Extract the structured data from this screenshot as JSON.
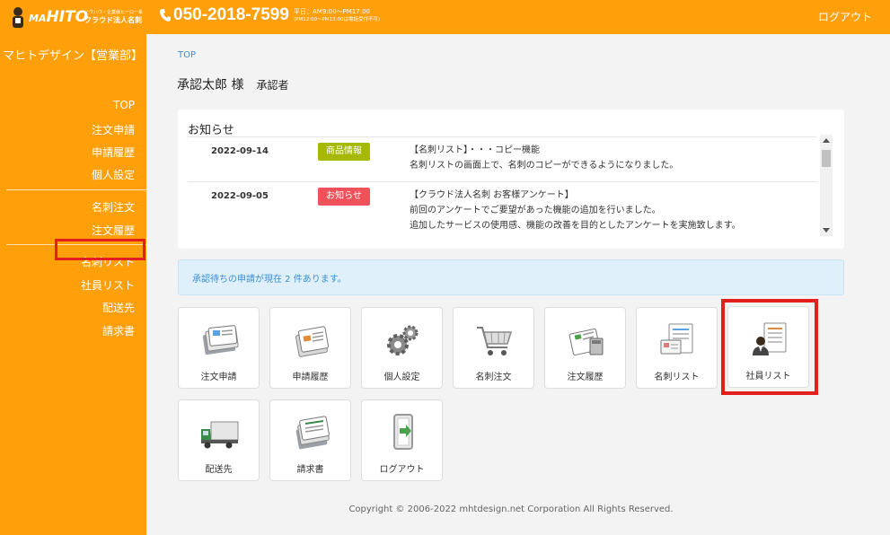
{
  "header": {
    "logo_brand": "HITO",
    "logo_prefix": "MA",
    "logo_tagline_small": "ノウハウ・企業様ヒーロー系",
    "logo_tagline": "クラウド法人名刺",
    "phone": "050-2018-7599",
    "hours_line1": "平日：AM9:00～PM17:00",
    "hours_line2": "(PM12:00～PM13:00は電話受付不可)",
    "logout": "ログアウト"
  },
  "sidebar": {
    "company": "マヒトデザイン【営業部】",
    "items": [
      {
        "label": "TOP"
      },
      {
        "label": "注文申請"
      },
      {
        "label": "申請履歴"
      },
      {
        "label": "個人設定"
      },
      {
        "label": "名刺注文"
      },
      {
        "label": "注文履歴"
      },
      {
        "label": "名刺リスト"
      },
      {
        "label": "社員リスト"
      },
      {
        "label": "配送先"
      },
      {
        "label": "請求書"
      }
    ]
  },
  "main": {
    "breadcrumb": "TOP",
    "user_name": "承認太郎 様",
    "user_role": "承認者",
    "notice_title": "お知らせ",
    "notices": [
      {
        "date": "2022-09-14",
        "badge": "商品情報",
        "badge_color": "#a6b800",
        "lines": [
          "【名刺リスト】・・・コピー機能",
          "名刺リストの画面上で、名刺のコピーができるようになりました。"
        ]
      },
      {
        "date": "2022-09-05",
        "badge": "お知らせ",
        "badge_color": "#f0515a",
        "lines": [
          "【クラウド法人名刺 お客様アンケート】",
          "前回のアンケートでご要望があった機能の追加を行いました。",
          "追加したサービスの使用感、機能の改善を目的としたアンケートを実施致します。"
        ]
      }
    ],
    "pending_message": "承認待ちの申請が現在 2 件あります。",
    "tiles": [
      {
        "label": "注文申請",
        "icon": "order-request-icon"
      },
      {
        "label": "申請履歴",
        "icon": "request-history-icon"
      },
      {
        "label": "個人設定",
        "icon": "gears-icon"
      },
      {
        "label": "名刺注文",
        "icon": "cart-icon"
      },
      {
        "label": "注文履歴",
        "icon": "order-history-icon"
      },
      {
        "label": "名刺リスト",
        "icon": "card-list-icon"
      },
      {
        "label": "社員リスト",
        "icon": "employee-list-icon"
      },
      {
        "label": "配送先",
        "icon": "truck-icon"
      },
      {
        "label": "請求書",
        "icon": "invoice-icon"
      },
      {
        "label": "ログアウト",
        "icon": "logout-door-icon"
      }
    ],
    "copyright": "Copyright © 2006-2022 mhtdesign.net Corporation All Rights Reserved."
  },
  "colors": {
    "brand_orange": "#ff9f0a",
    "highlight_red": "#e21e1e",
    "link_blue": "#3b8ed6"
  }
}
